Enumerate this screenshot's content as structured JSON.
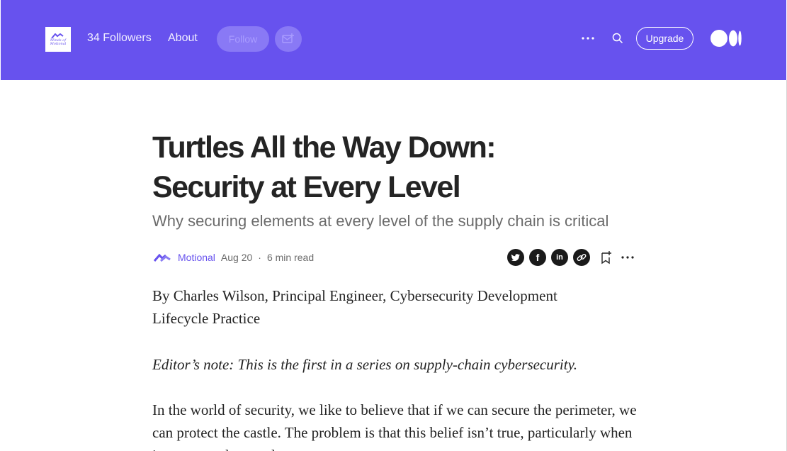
{
  "header": {
    "publication_logo_text": "Minds of Motional",
    "followers": "34 Followers",
    "about": "About",
    "follow": "Follow",
    "upgrade": "Upgrade",
    "icons": [
      "mail-plus-icon",
      "more-icon",
      "search-icon",
      "medium-logo-icon"
    ],
    "background_color": "#6752ee"
  },
  "article": {
    "title": "Turtles All the Way Down: Security at Every Level",
    "subtitle": "Why securing elements at every level of the supply chain is critical",
    "author": "Motional",
    "date": "Aug 20",
    "separator": "·",
    "read_time": "6 min read",
    "share_icons": [
      "twitter-icon",
      "facebook-icon",
      "linkedin-icon",
      "copy-link-icon",
      "bookmark-icon",
      "more-icon"
    ],
    "paragraphs": [
      "By Charles Wilson, Principal Engineer, Cybersecurity Development Lifecycle Practice",
      "Editor’s note: This is the first in a series on supply-chain cybersecurity.",
      "In the world of security, we like to believe that if we can secure the perimeter, we can protect the castle. The problem is that this belief isn’t true, particularly when it comes to the supply"
    ]
  }
}
